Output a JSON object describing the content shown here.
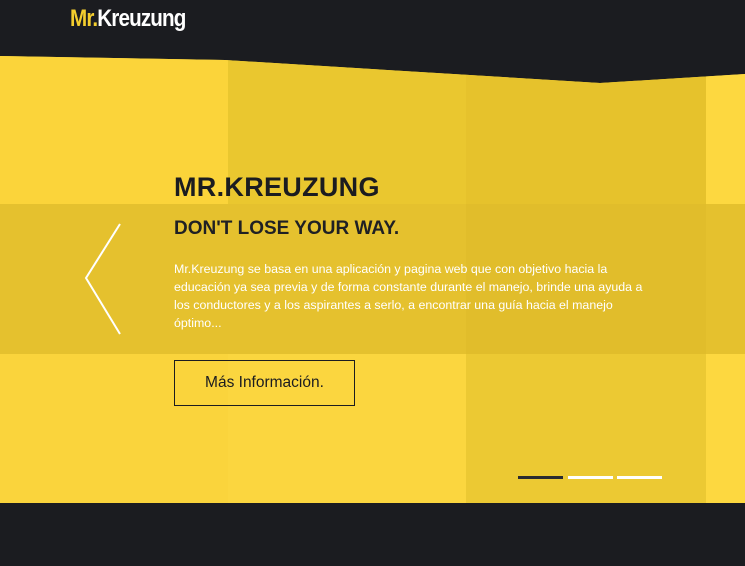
{
  "header": {
    "logo_part1": "Mr.",
    "logo_part2": "Kreuzung"
  },
  "hero": {
    "title": "MR.KREUZUNG",
    "subtitle": "DON'T LOSE YOUR WAY.",
    "description": "Mr.Kreuzung se basa en una aplicación y pagina web que con objetivo hacia la educación ya sea previa y de forma constante durante el manejo, brinde una ayuda a los conductores y a los aspirantes a serlo, a encontrar una guía hacia el manejo óptimo...",
    "cta_label": "Más Información.",
    "prev_icon": "chevron-left-icon",
    "slides_count": 3,
    "active_slide": 1
  },
  "colors": {
    "dark": "#1b1c20",
    "accent": "#fcd53c"
  }
}
